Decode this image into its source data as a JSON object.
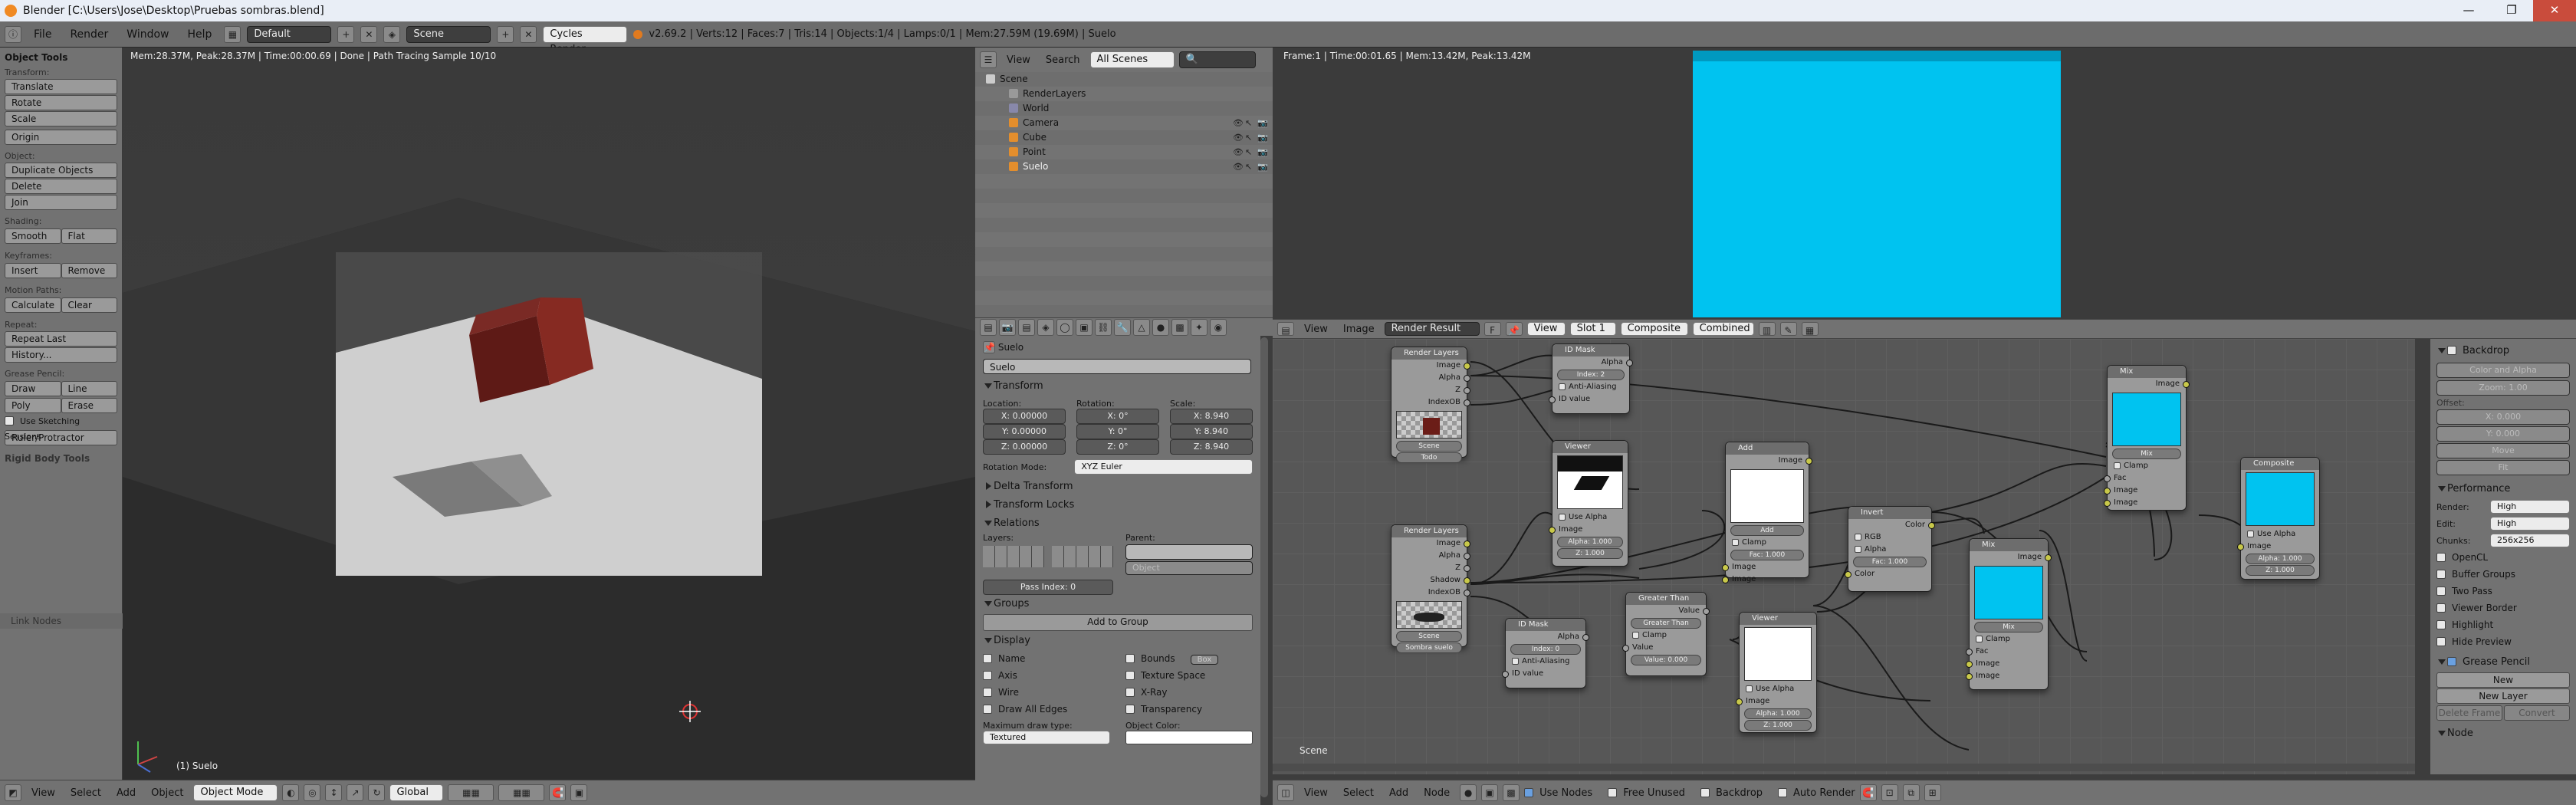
{
  "window": {
    "title": "Blender [C:\\Users\\Jose\\Desktop\\Pruebas sombras.blend]",
    "controls": [
      "—",
      "❐",
      "✕"
    ]
  },
  "infobar": {
    "menus": [
      "File",
      "Render",
      "Window",
      "Help"
    ],
    "screen": "Default",
    "scene": "Scene",
    "engine": "Cycles Render",
    "stats": "v2.69.2 | Verts:12 | Faces:7 | Tris:14 | Objects:1/4 | Lamps:0/1 | Mem:27.59M (19.69M) | Suelo"
  },
  "toolshelf": {
    "header": "Object Tools",
    "transform_label": "Transform:",
    "translate": "Translate",
    "rotate": "Rotate",
    "scale": "Scale",
    "origin": "Origin",
    "object_label": "Object:",
    "duplicate": "Duplicate Objects",
    "delete": "Delete",
    "join": "Join",
    "shading_label": "Shading:",
    "smooth": "Smooth",
    "flat": "Flat",
    "keyframes_label": "Keyframes:",
    "insert": "Insert",
    "remove": "Remove",
    "motion_label": "Motion Paths:",
    "calculate": "Calculate",
    "clear": "Clear",
    "repeat_label": "Repeat:",
    "repeat_last": "Repeat Last",
    "history": "History...",
    "grease_label": "Grease Pencil:",
    "draw": "Draw",
    "line": "Line",
    "poly": "Poly",
    "erase": "Erase",
    "use_sketching": "Use Sketching Sessions",
    "ruler": "Ruler/Protractor",
    "rigid_body": "Rigid Body Tools",
    "link_nodes": "Link Nodes"
  },
  "viewport": {
    "stats": "Mem:28.37M, Peak:28.37M | Time:00:00.69 | Done | Path Tracing Sample 10/10",
    "object_label": "(1) Suelo",
    "menus": [
      "View",
      "Select",
      "Add",
      "Object"
    ],
    "mode": "Object Mode",
    "orientation": "Global"
  },
  "outliner": {
    "menus": [
      "View",
      "Search"
    ],
    "filter": "All Scenes",
    "items": [
      {
        "label": "Scene",
        "indent": 0
      },
      {
        "label": "RenderLayers",
        "indent": 1
      },
      {
        "label": "World",
        "indent": 1
      },
      {
        "label": "Camera",
        "indent": 1
      },
      {
        "label": "Cube",
        "indent": 1
      },
      {
        "label": "Point",
        "indent": 1
      },
      {
        "label": "Suelo",
        "indent": 1
      }
    ]
  },
  "properties": {
    "breadcrumb": "Suelo",
    "name": "Suelo",
    "transform": "Transform",
    "location": "Location:",
    "rotation": "Rotation:",
    "scale": "Scale:",
    "loc": [
      "X: 0.00000",
      "Y: 0.00000",
      "Z: 0.00000"
    ],
    "rot": [
      "X: 0°",
      "Y: 0°",
      "Z: 0°"
    ],
    "scl": [
      "X: 8.940",
      "Y: 8.940",
      "Z: 8.940"
    ],
    "rotation_mode_label": "Rotation Mode:",
    "rotation_mode": "XYZ Euler",
    "delta": "Delta Transform",
    "locks": "Transform Locks",
    "relations": "Relations",
    "layers": "Layers:",
    "parent": "Parent:",
    "parent_type": "Object",
    "pass_index": "Pass Index: 0",
    "groups": "Groups",
    "add_to_group": "Add to Group",
    "display": "Display",
    "name_chk": "Name",
    "axis": "Axis",
    "wire": "Wire",
    "draw_all_edges": "Draw All Edges",
    "bounds": "Bounds",
    "bounds_type": "Box",
    "texture_space": "Texture Space",
    "xray": "X-Ray",
    "transparency": "Transparency",
    "max_draw_label": "Maximum draw type:",
    "max_draw": "Textured",
    "obj_color_label": "Object Color:"
  },
  "render_view": {
    "stats": "Frame:1 | Time:00:01.65 | Mem:13.42M, Peak:13.42M",
    "preview_color": "#00c3f0"
  },
  "node_editor": {
    "menus": [
      "View",
      "Image"
    ],
    "image": "Render Result",
    "view": "View",
    "slot": "Slot 1",
    "pass": "Composite",
    "combined": "Combined",
    "scene_label": "Scene",
    "footer_menus": [
      "View",
      "Select",
      "Add",
      "Node"
    ],
    "use_nodes": "Use Nodes",
    "free_unused": "Free Unused",
    "backdrop": "Backdrop",
    "auto_render": "Auto Render"
  },
  "nodes": {
    "rl1": {
      "title": "Render Layers",
      "outs": [
        "Image",
        "Alpha",
        "Z",
        "IndexOB"
      ],
      "scene": "Scene",
      "layer": "Todo"
    },
    "rl2": {
      "title": "Render Layers",
      "outs": [
        "Image",
        "Alpha",
        "Z",
        "Shadow",
        "IndexOB"
      ],
      "scene": "Scene",
      "layer": "Sombra suelo"
    },
    "idmask1": {
      "title": "ID Mask",
      "out": "Alpha",
      "index": "Index: 2",
      "anti": "Anti-Aliasing",
      "in": "ID value"
    },
    "idmask2": {
      "title": "ID Mask",
      "out": "Alpha",
      "index": "Index: 0",
      "anti": "Anti-Aliasing",
      "in": "ID value"
    },
    "viewer1": {
      "title": "Viewer",
      "use_alpha": "Use Alpha",
      "image": "Image",
      "alpha": "Alpha: 1.000",
      "z": "Z: 1.000"
    },
    "viewer2": {
      "title": "Viewer",
      "use_alpha": "Use Alpha",
      "image": "Image",
      "alpha": "Alpha: 1.000",
      "z": "Z: 1.000"
    },
    "add": {
      "title": "Add",
      "out": "Image",
      "op": "Add",
      "clamp": "Clamp",
      "fac": "Fac: 1.000",
      "in1": "Image",
      "in2": "Image"
    },
    "gt": {
      "title": "Greater Than",
      "out": "Value",
      "op": "Greater Than",
      "clamp": "Clamp",
      "in1": "Value",
      "val": "Value: 0.000"
    },
    "invert": {
      "title": "Invert",
      "out": "Color",
      "rgb": "RGB",
      "alpha": "Alpha",
      "fac": "Fac: 1.000",
      "in": "Color"
    },
    "mix1": {
      "title": "Mix",
      "out": "Image",
      "op": "Mix",
      "clamp": "Clamp",
      "fac": "Fac",
      "in1": "Image",
      "in2": "Image"
    },
    "mix2": {
      "title": "Mix",
      "out": "Image",
      "op": "Mix",
      "clamp": "Clamp",
      "fac": "Fac",
      "in1": "Image",
      "in2": "Image"
    },
    "composite": {
      "title": "Composite",
      "use_alpha": "Use Alpha",
      "image": "Image",
      "alpha": "Alpha: 1.000",
      "z": "Z: 1.000"
    }
  },
  "npanel": {
    "backdrop": "Backdrop",
    "channels": "Color and Alpha",
    "zoom": "Zoom: 1.00",
    "offset": "Offset:",
    "x": "X: 0.000",
    "y": "Y: 0.000",
    "move": "Move",
    "fit": "Fit",
    "performance": "Performance",
    "render_label": "Render:",
    "render_val": "High",
    "edit_label": "Edit:",
    "edit_val": "High",
    "chunks_label": "Chunks:",
    "chunks_val": "256x256",
    "opencl": "OpenCL",
    "buffer": "Buffer Groups",
    "two_pass": "Two Pass",
    "viewer_border": "Viewer Border",
    "highlight": "Highlight",
    "hide_preview": "Hide Preview",
    "grease": "Grease Pencil",
    "new": "New",
    "new_layer": "New Layer",
    "delete_frame": "Delete Frame",
    "convert": "Convert",
    "node": "Node"
  }
}
